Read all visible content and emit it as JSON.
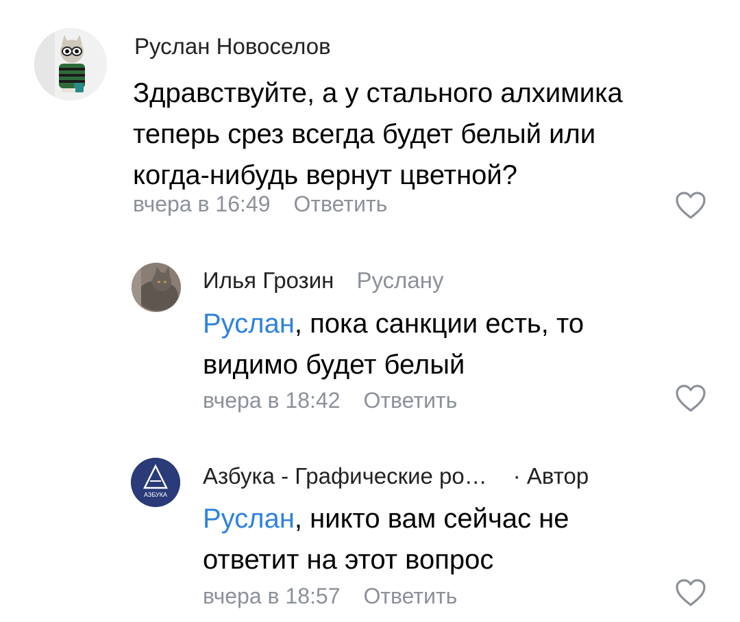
{
  "comments": [
    {
      "author": "Руслан Новоселов",
      "text_lines": [
        "Здравствуйте, а у стального алхимика",
        "теперь срез всегда будет белый или",
        "когда-нибудь вернут цветной?"
      ],
      "time": "вчера в 16:49",
      "reply_label": "Ответить",
      "avatar_icon": "cat-with-sunglasses-avatar"
    },
    {
      "author": "Илья Грозин",
      "reply_to": "Руслану",
      "mention": "Руслан",
      "text_lines": [
        ", пока санкции есть, то",
        "видимо будет белый"
      ],
      "time": "вчера в 18:42",
      "reply_label": "Ответить",
      "avatar_icon": "cat-photo-avatar"
    },
    {
      "author": "Азбука - Графические ро…",
      "badge": "· Автор",
      "mention": "Руслан",
      "text_lines": [
        ", никто вам сейчас не",
        "ответит на этот вопрос"
      ],
      "time": "вчера в 18:57",
      "reply_label": "Ответить",
      "avatar_icon": "azbuka-logo-avatar",
      "avatar_text": "АЗБУКА"
    }
  ],
  "colors": {
    "mention": "#2d81e0",
    "meta": "#8b9099",
    "text": "#000000"
  }
}
